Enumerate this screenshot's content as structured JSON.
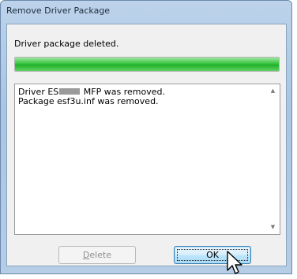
{
  "window": {
    "title": "Remove Driver Package"
  },
  "status": {
    "message": "Driver package deleted.",
    "progress_percent": 100
  },
  "log": {
    "line1_prefix": "Driver ES",
    "line1_suffix": "MFP was removed.",
    "line2": "Package esf3u.inf was removed."
  },
  "buttons": {
    "delete_label": "Delete",
    "delete_accelerator": "D",
    "delete_rest": "elete",
    "ok_label": "OK"
  },
  "colors": {
    "progress": "#22b02a",
    "ok_border": "#3c7fb1"
  },
  "icons": {
    "scroll_up": "triangle-up",
    "scroll_down": "triangle-down",
    "cursor": "arrow-pointer"
  }
}
